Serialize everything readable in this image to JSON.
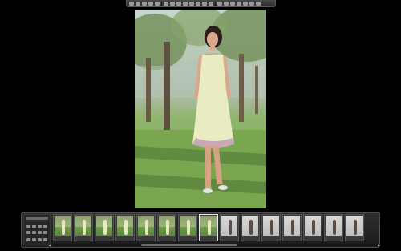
{
  "toolbar": {
    "buttons": [
      "rotate-left-icon",
      "rotate-right-icon",
      "crop-icon",
      "copy-icon",
      "tag-icon",
      "image-icon",
      "settings-icon",
      "zoom-icon",
      "star-icon",
      "star-icon",
      "star-icon",
      "star-icon",
      "star-icon",
      "flag-icon",
      "list-icon",
      "grid-icon",
      "sort-icon",
      "filter-icon",
      "info-icon",
      "fullscreen-icon"
    ]
  },
  "photo": {
    "description_icon": "main-photo"
  },
  "panel": {
    "controls_title": "",
    "thumbnails": [
      {
        "selected": false,
        "scene": "outdoor"
      },
      {
        "selected": false,
        "scene": "outdoor"
      },
      {
        "selected": false,
        "scene": "outdoor"
      },
      {
        "selected": false,
        "scene": "outdoor"
      },
      {
        "selected": false,
        "scene": "outdoor"
      },
      {
        "selected": false,
        "scene": "outdoor"
      },
      {
        "selected": false,
        "scene": "outdoor"
      },
      {
        "selected": true,
        "scene": "outdoor"
      },
      {
        "selected": false,
        "scene": "studio"
      },
      {
        "selected": false,
        "scene": "studio"
      },
      {
        "selected": false,
        "scene": "studio"
      },
      {
        "selected": false,
        "scene": "studio"
      },
      {
        "selected": false,
        "scene": "studio"
      },
      {
        "selected": false,
        "scene": "studio"
      },
      {
        "selected": false,
        "scene": "studio"
      }
    ],
    "scroll_left_icon": "◀",
    "scroll_right_icon": "▶"
  }
}
